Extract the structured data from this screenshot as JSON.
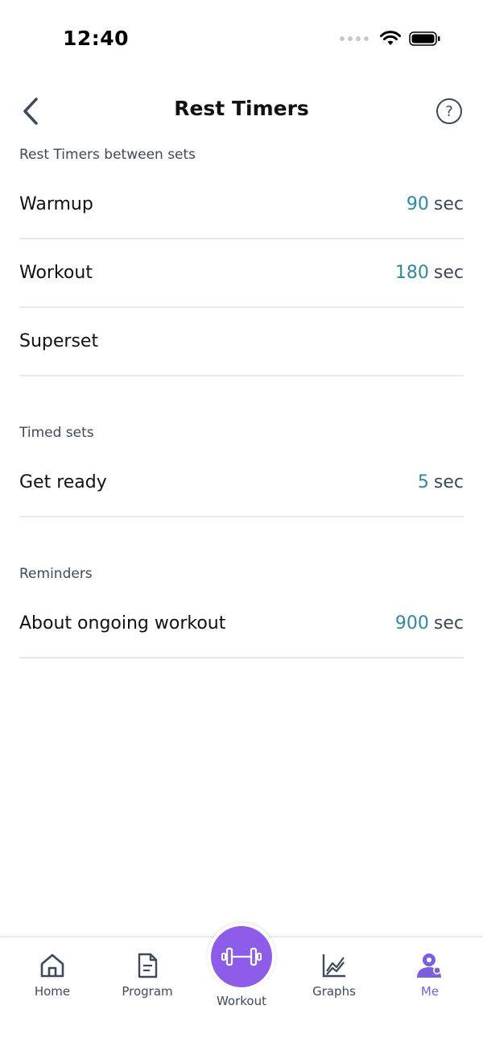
{
  "status_bar": {
    "time": "12:40"
  },
  "header": {
    "title": "Rest Timers",
    "back_icon": "chevron-left-icon",
    "help_label": "?"
  },
  "sections": [
    {
      "label": "Rest Timers between sets",
      "rows": [
        {
          "label": "Warmup",
          "value": "90",
          "unit": "sec"
        },
        {
          "label": "Workout",
          "value": "180",
          "unit": "sec"
        },
        {
          "label": "Superset",
          "value": "",
          "unit": ""
        }
      ]
    },
    {
      "label": "Timed sets",
      "rows": [
        {
          "label": "Get ready",
          "value": "5",
          "unit": "sec"
        }
      ]
    },
    {
      "label": "Reminders",
      "rows": [
        {
          "label": "About ongoing workout",
          "value": "900",
          "unit": "sec"
        }
      ]
    }
  ],
  "tab_bar": {
    "items": [
      {
        "label": "Home",
        "icon": "home-icon"
      },
      {
        "label": "Program",
        "icon": "document-icon"
      },
      {
        "label": "Workout",
        "icon": "dumbbell-icon"
      },
      {
        "label": "Graphs",
        "icon": "chart-icon"
      },
      {
        "label": "Me",
        "icon": "profile-icon"
      }
    ],
    "active": "Me"
  },
  "colors": {
    "accent_purple": "#8d5ce8",
    "value_teal": "#2e8a9e",
    "active_tab": "#7b5fe0"
  }
}
